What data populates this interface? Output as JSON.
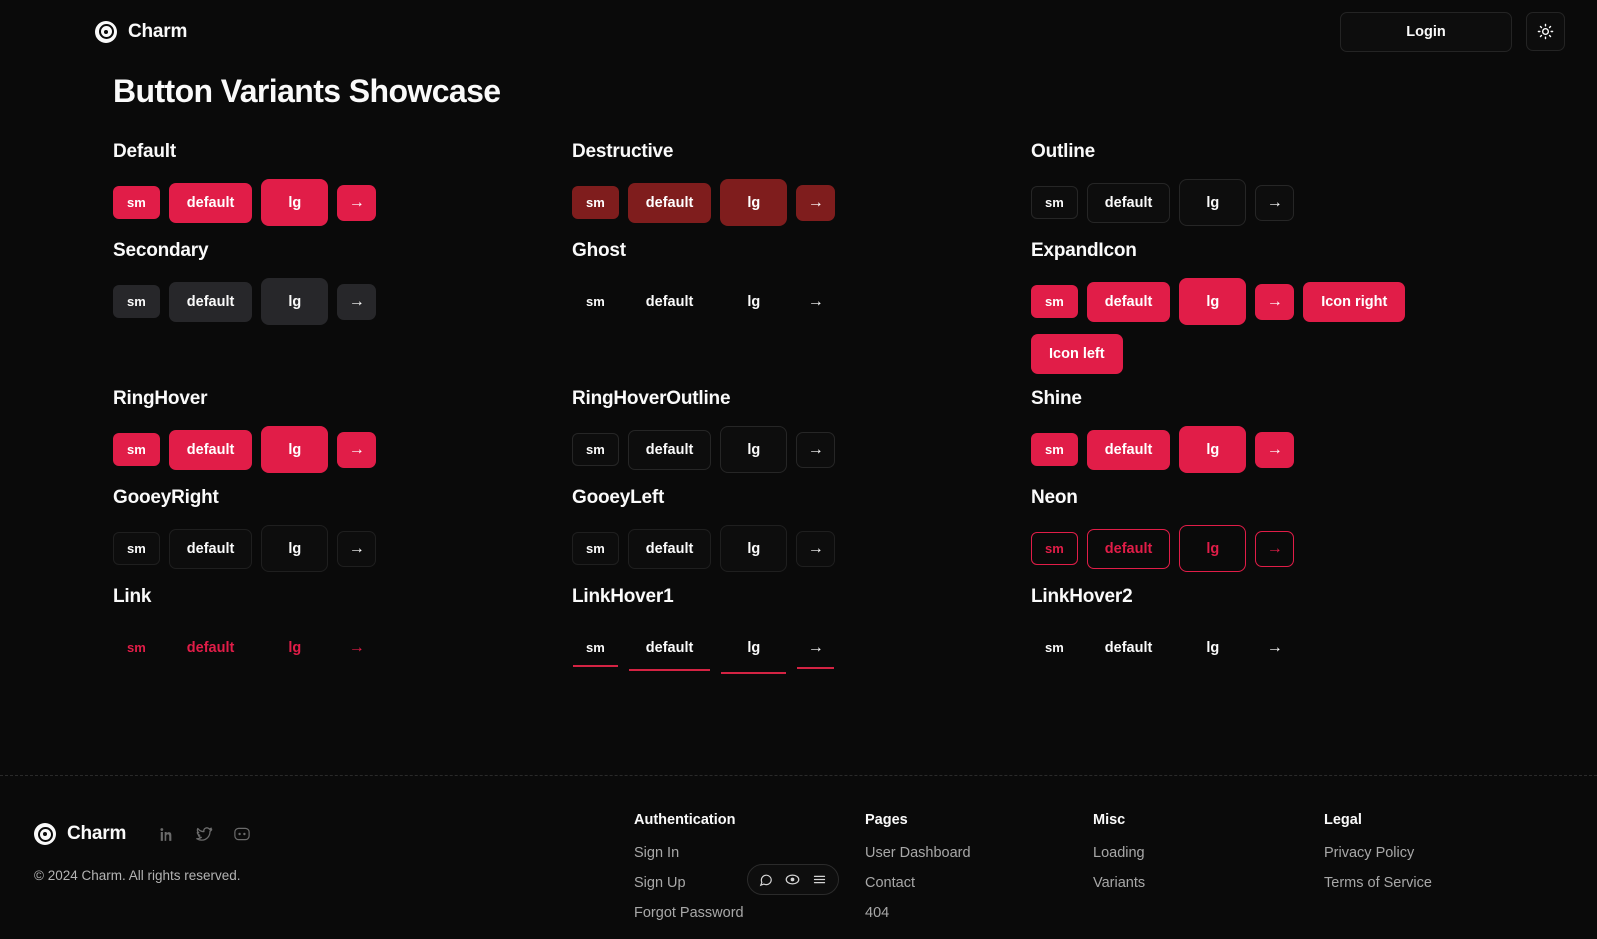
{
  "header": {
    "brand": "Charm",
    "brand_icon": "target-circle-icon",
    "login_label": "Login",
    "theme_toggle_icon": "sun-icon"
  },
  "main": {
    "page_title": "Button Variants Showcase",
    "accent_color": "#e11d48",
    "destructive_color": "#7f1d1d",
    "secondary_color": "#27272a",
    "groups": [
      {
        "title": "Default",
        "variant": "default",
        "buttons": [
          {
            "label": "sm",
            "size": "sm"
          },
          {
            "label": "default",
            "size": "def"
          },
          {
            "label": "lg",
            "size": "lg"
          },
          {
            "label": "→",
            "size": "icon"
          }
        ]
      },
      {
        "title": "Destructive",
        "variant": "destructive",
        "buttons": [
          {
            "label": "sm",
            "size": "sm"
          },
          {
            "label": "default",
            "size": "def"
          },
          {
            "label": "lg",
            "size": "lg"
          },
          {
            "label": "→",
            "size": "icon"
          }
        ]
      },
      {
        "title": "Outline",
        "variant": "outline",
        "buttons": [
          {
            "label": "sm",
            "size": "sm"
          },
          {
            "label": "default",
            "size": "def"
          },
          {
            "label": "lg",
            "size": "lg"
          },
          {
            "label": "→",
            "size": "icon"
          }
        ]
      },
      {
        "title": "Secondary",
        "variant": "secondary",
        "buttons": [
          {
            "label": "sm",
            "size": "sm"
          },
          {
            "label": "default",
            "size": "def"
          },
          {
            "label": "lg",
            "size": "lg"
          },
          {
            "label": "→",
            "size": "icon"
          }
        ]
      },
      {
        "title": "Ghost",
        "variant": "ghost",
        "buttons": [
          {
            "label": "sm",
            "size": "sm"
          },
          {
            "label": "default",
            "size": "def"
          },
          {
            "label": "lg",
            "size": "lg"
          },
          {
            "label": "→",
            "size": "icon"
          }
        ]
      },
      {
        "title": "ExpandIcon",
        "variant": "expand",
        "buttons": [
          {
            "label": "sm",
            "size": "sm"
          },
          {
            "label": "default",
            "size": "def"
          },
          {
            "label": "lg",
            "size": "lg"
          },
          {
            "label": "→",
            "size": "icon"
          },
          {
            "label": "Icon right",
            "size": "wide"
          },
          {
            "label": "Icon left",
            "size": "wide"
          }
        ]
      },
      {
        "title": "RingHover",
        "variant": "ringhover",
        "buttons": [
          {
            "label": "sm",
            "size": "sm"
          },
          {
            "label": "default",
            "size": "def"
          },
          {
            "label": "lg",
            "size": "lg"
          },
          {
            "label": "→",
            "size": "icon"
          }
        ]
      },
      {
        "title": "RingHoverOutline",
        "variant": "ringoutline",
        "buttons": [
          {
            "label": "sm",
            "size": "sm"
          },
          {
            "label": "default",
            "size": "def"
          },
          {
            "label": "lg",
            "size": "lg"
          },
          {
            "label": "→",
            "size": "icon"
          }
        ]
      },
      {
        "title": "Shine",
        "variant": "shine",
        "buttons": [
          {
            "label": "sm",
            "size": "sm"
          },
          {
            "label": "default",
            "size": "def"
          },
          {
            "label": "lg",
            "size": "lg"
          },
          {
            "label": "→",
            "size": "icon"
          }
        ]
      },
      {
        "title": "GooeyRight",
        "variant": "gooey",
        "buttons": [
          {
            "label": "sm",
            "size": "sm"
          },
          {
            "label": "default",
            "size": "def"
          },
          {
            "label": "lg",
            "size": "lg"
          },
          {
            "label": "→",
            "size": "icon"
          }
        ]
      },
      {
        "title": "GooeyLeft",
        "variant": "gooey",
        "buttons": [
          {
            "label": "sm",
            "size": "sm"
          },
          {
            "label": "default",
            "size": "def"
          },
          {
            "label": "lg",
            "size": "lg"
          },
          {
            "label": "→",
            "size": "icon"
          }
        ]
      },
      {
        "title": "Neon",
        "variant": "neon",
        "buttons": [
          {
            "label": "sm",
            "size": "sm"
          },
          {
            "label": "default",
            "size": "def"
          },
          {
            "label": "lg",
            "size": "lg"
          },
          {
            "label": "→",
            "size": "icon"
          }
        ]
      },
      {
        "title": "Link",
        "variant": "link",
        "buttons": [
          {
            "label": "sm",
            "size": "sm"
          },
          {
            "label": "default",
            "size": "def"
          },
          {
            "label": "lg",
            "size": "lg"
          },
          {
            "label": "→",
            "size": "icon"
          }
        ]
      },
      {
        "title": "LinkHover1",
        "variant": "linkhover1",
        "buttons": [
          {
            "label": "sm",
            "size": "sm"
          },
          {
            "label": "default",
            "size": "def"
          },
          {
            "label": "lg",
            "size": "lg"
          },
          {
            "label": "→",
            "size": "icon"
          }
        ]
      },
      {
        "title": "LinkHover2",
        "variant": "linkhover2",
        "buttons": [
          {
            "label": "sm",
            "size": "sm"
          },
          {
            "label": "default",
            "size": "def"
          },
          {
            "label": "lg",
            "size": "lg"
          },
          {
            "label": "→",
            "size": "icon"
          }
        ]
      }
    ]
  },
  "footer": {
    "brand": "Charm",
    "copyright": "© 2024 Charm. All rights reserved.",
    "socials": [
      "linkedin-icon",
      "twitter-icon",
      "discord-icon"
    ],
    "columns": [
      {
        "title": "Authentication",
        "links": [
          "Sign In",
          "Sign Up",
          "Forgot Password"
        ]
      },
      {
        "title": "Pages",
        "links": [
          "User Dashboard",
          "Contact",
          "404"
        ]
      },
      {
        "title": "Misc",
        "links": [
          "Loading",
          "Variants"
        ]
      },
      {
        "title": "Legal",
        "links": [
          "Privacy Policy",
          "Terms of Service"
        ]
      }
    ]
  },
  "widget": {
    "icons": [
      "chat-bubble-icon",
      "eye-icon",
      "menu-icon"
    ]
  }
}
